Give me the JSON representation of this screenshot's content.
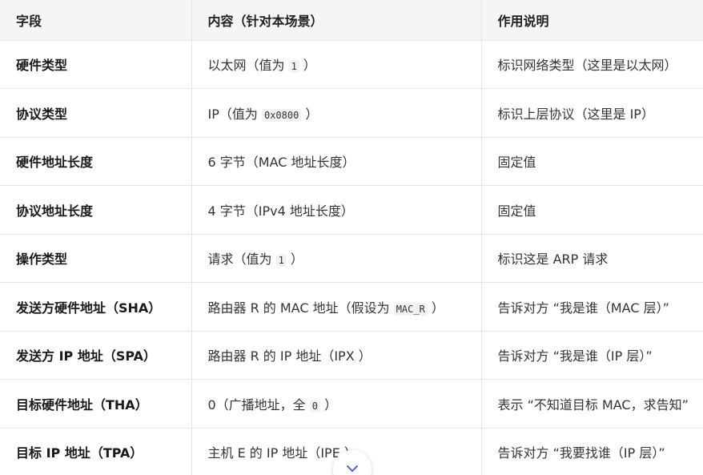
{
  "headers": [
    "字段",
    "内容（针对本场景）",
    "作用说明"
  ],
  "rows": [
    {
      "field": "硬件类型",
      "content_pre": "以太网（值为 ",
      "code": "1",
      "content_post": " ）",
      "desc": "标识网络类型（这里是以太网）"
    },
    {
      "field": "协议类型",
      "content_pre": "IP（值为 ",
      "code": "0x0800",
      "content_post": " ）",
      "desc": "标识上层协议（这里是 IP）"
    },
    {
      "field": "硬件地址长度",
      "content_pre": "6 字节（MAC 地址长度）",
      "code": "",
      "content_post": "",
      "desc": "固定值"
    },
    {
      "field": "协议地址长度",
      "content_pre": "4 字节（IPv4 地址长度）",
      "code": "",
      "content_post": "",
      "desc": "固定值"
    },
    {
      "field": "操作类型",
      "content_pre": "请求（值为 ",
      "code": "1",
      "content_post": " ）",
      "desc": "标识这是 ARP 请求"
    },
    {
      "field": "发送方硬件地址（SHA）",
      "content_pre": "路由器 R 的 MAC 地址（假设为 ",
      "code": "MAC_R",
      "content_post": " ）",
      "desc": "告诉对方 “我是谁（MAC 层）”"
    },
    {
      "field": "发送方 IP 地址（SPA）",
      "content_pre": "路由器 R 的 IP 地址（IPX ）",
      "code": "",
      "content_post": "",
      "desc": "告诉对方 “我是谁（IP 层）”"
    },
    {
      "field": "目标硬件地址（THA）",
      "content_pre": "0（广播地址，全 ",
      "code": "0",
      "content_post": " ）",
      "desc": "表示 “不知道目标 MAC，求告知”"
    },
    {
      "field": "目标 IP 地址（TPA）",
      "content_pre": "主机 E 的 IP 地址（IPE ）",
      "code": "",
      "content_post": "",
      "desc": "告诉对方 “我要找谁（IP 层）”"
    }
  ],
  "scroll_button": {
    "icon": "chevron-down-icon"
  }
}
